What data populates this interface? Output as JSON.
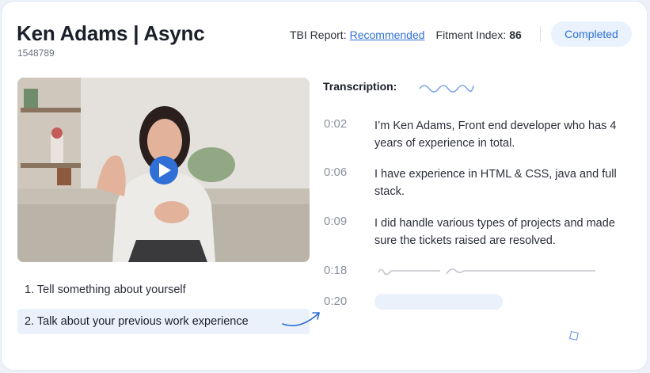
{
  "candidate": {
    "name_title": "Ken Adams | Async",
    "id": "1548789"
  },
  "header": {
    "tbi_label": "TBI Report:",
    "tbi_value": "Recommended",
    "fitment_label": "Fitment Index:",
    "fitment_value": "86",
    "status": "Completed"
  },
  "video": {
    "play_icon": "play-icon"
  },
  "questions": [
    {
      "label": "1. Tell something about yourself"
    },
    {
      "label": "2. Talk about your previous work experience"
    }
  ],
  "transcription": {
    "label": "Transcription:",
    "entries": [
      {
        "time": "0:02",
        "text": "I’m Ken Adams, Front end developer who has 4 years of experience in total."
      },
      {
        "time": "0:06",
        "text": "I have experience in HTML & CSS, java and full stack."
      },
      {
        "time": "0:09",
        "text": "I did handle various types of projects and made sure the tickets raised are resolved."
      },
      {
        "time": "0:18",
        "text": ""
      },
      {
        "time": "0:20",
        "text": ""
      }
    ]
  },
  "colors": {
    "accent": "#2f6fd6",
    "badge_bg": "#e9f2fd",
    "highlight": "#eaf1fb"
  }
}
